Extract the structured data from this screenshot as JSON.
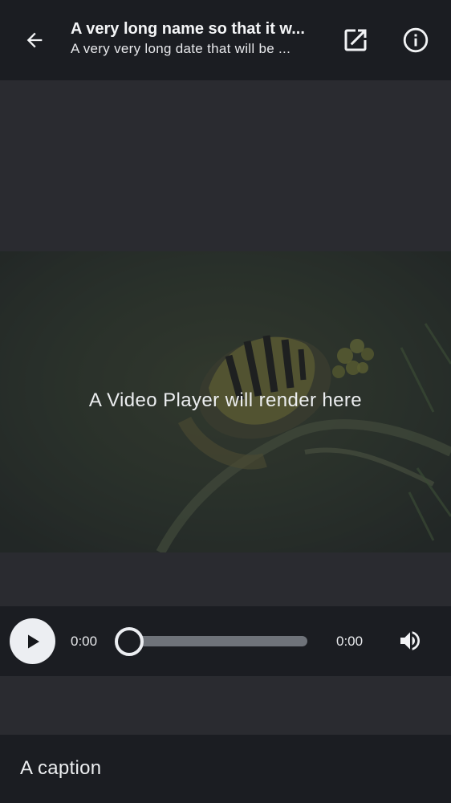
{
  "header": {
    "title": "A very long name so that it w...",
    "subtitle": "A very very long date that will be ...",
    "back_icon": "arrow-left-icon",
    "external_icon": "open-external-icon",
    "info_icon": "info-icon"
  },
  "video": {
    "placeholder_text": "A Video Player will render here"
  },
  "controls": {
    "play_icon": "play-icon",
    "current_time": "0:00",
    "total_time": "0:00",
    "progress": 0,
    "volume_icon": "volume-icon"
  },
  "caption": {
    "text": "A caption"
  },
  "colors": {
    "header_bg": "#1b1d22",
    "page_bg": "#2a2b30",
    "accent": "#eceef2"
  }
}
